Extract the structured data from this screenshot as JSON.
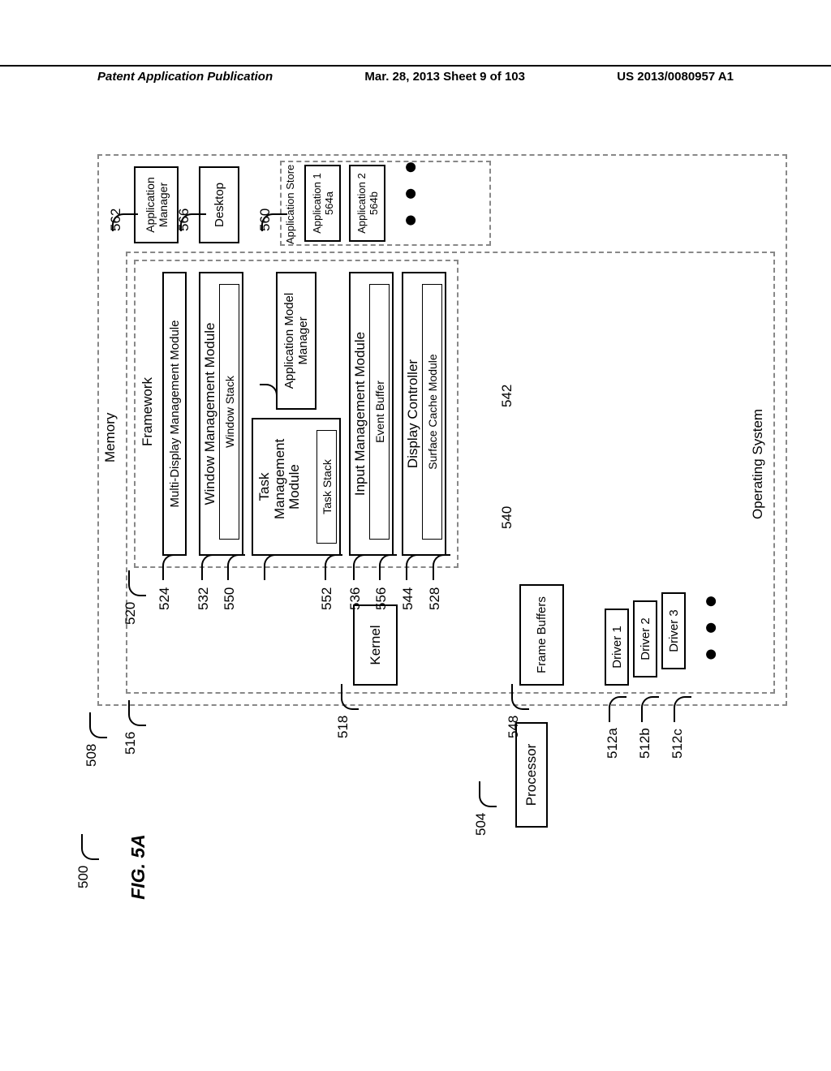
{
  "header": {
    "left": "Patent Application Publication",
    "mid": "Mar. 28, 2013  Sheet 9 of 103",
    "right": "US 2013/0080957 A1"
  },
  "fig": "FIG. 5A",
  "refs": {
    "r500": "500",
    "r504": "504",
    "r508": "508",
    "r512a": "512a",
    "r512b": "512b",
    "r512c": "512c",
    "r516": "516",
    "r518": "518",
    "r520": "520",
    "r524": "524",
    "r528": "528",
    "r532": "532",
    "r536": "536",
    "r540": "540",
    "r542": "542",
    "r544": "544",
    "r548": "548",
    "r550": "550",
    "r552": "552",
    "r556": "556",
    "r560": "560",
    "r562": "562",
    "r566": "566"
  },
  "boxes": {
    "processor": "Processor",
    "memory": "Memory",
    "os": "Operating System",
    "kernel": "Kernel",
    "framebuffers": "Frame Buffers",
    "driver1": "Driver 1",
    "driver2": "Driver 2",
    "driver3": "Driver 3",
    "framework": "Framework",
    "mdm": "Multi-Display Management Module",
    "wmm": "Window Management Module",
    "windowstack": "Window Stack",
    "tmm": "Task\nManagement\nModule",
    "taskstack": "Task Stack",
    "amm": "Application Model\nManager",
    "imm": "Input Management Module",
    "eventbuffer": "Event Buffer",
    "dispctrl": "Display Controller",
    "scm": "Surface Cache Module",
    "appmgr": "Application\nManager",
    "desktop": "Desktop",
    "appstore": "Application Store",
    "app1": "Application 1\n564a",
    "app2": "Application 2\n564b",
    "dots": "● ● ●"
  }
}
